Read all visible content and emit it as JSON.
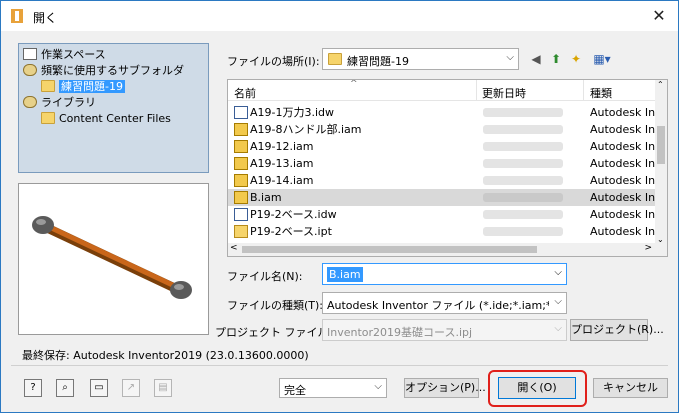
{
  "window": {
    "title": "開く",
    "close_glyph": "✕"
  },
  "places": [
    {
      "label": "作業スペース",
      "icon": "workspace-icon"
    },
    {
      "label": "頻繁に使用するサブフォルダ",
      "icon": "library-icon"
    },
    {
      "label": "練習問題-19",
      "icon": "folder-icon",
      "selected": true
    },
    {
      "label": "ライブラリ",
      "icon": "library-icon"
    },
    {
      "label": "Content Center Files",
      "icon": "folder-icon"
    }
  ],
  "location": {
    "label": "ファイルの場所(I):",
    "value": "練習問題-19"
  },
  "file_list": {
    "columns": [
      "名前",
      "更新日時",
      "種類"
    ],
    "rows": [
      {
        "name": "A19-1万力3.idw",
        "type": "Autodesk In",
        "kind": "idw"
      },
      {
        "name": "A19-8ハンドル部.iam",
        "type": "Autodesk In",
        "kind": "iam"
      },
      {
        "name": "A19-12.iam",
        "type": "Autodesk In",
        "kind": "iam"
      },
      {
        "name": "A19-13.iam",
        "type": "Autodesk In",
        "kind": "iam"
      },
      {
        "name": "A19-14.iam",
        "type": "Autodesk In",
        "kind": "iam"
      },
      {
        "name": "B.iam",
        "type": "Autodesk In",
        "kind": "iam",
        "selected": true
      },
      {
        "name": "P19-2ベース.idw",
        "type": "Autodesk In",
        "kind": "idw"
      },
      {
        "name": "P19-2ベース.ipt",
        "type": "Autodesk In",
        "kind": "ipt"
      }
    ]
  },
  "filename": {
    "label": "ファイル名(N):",
    "value": "B.iam"
  },
  "filetype": {
    "label": "ファイルの種類(T):",
    "value": "Autodesk Inventor ファイル (*.ide;*.iam;*.ipt;*.ipn"
  },
  "project": {
    "label": "プロジェクト ファイル(J):",
    "value": "Inventor2019基礎コース.ipj",
    "button": "プロジェクト(R)..."
  },
  "last_saved": "最終保存: Autodesk Inventor2019 (23.0.13600.0000)",
  "footer": {
    "mode_value": "完全",
    "options_button": "オプション(P)...",
    "open_button": "開く(O)",
    "cancel_button": "キャンセル"
  },
  "colors": {
    "accent": "#0078d7",
    "selection": "#3399ff",
    "highlight_outline": "#e0201b"
  }
}
